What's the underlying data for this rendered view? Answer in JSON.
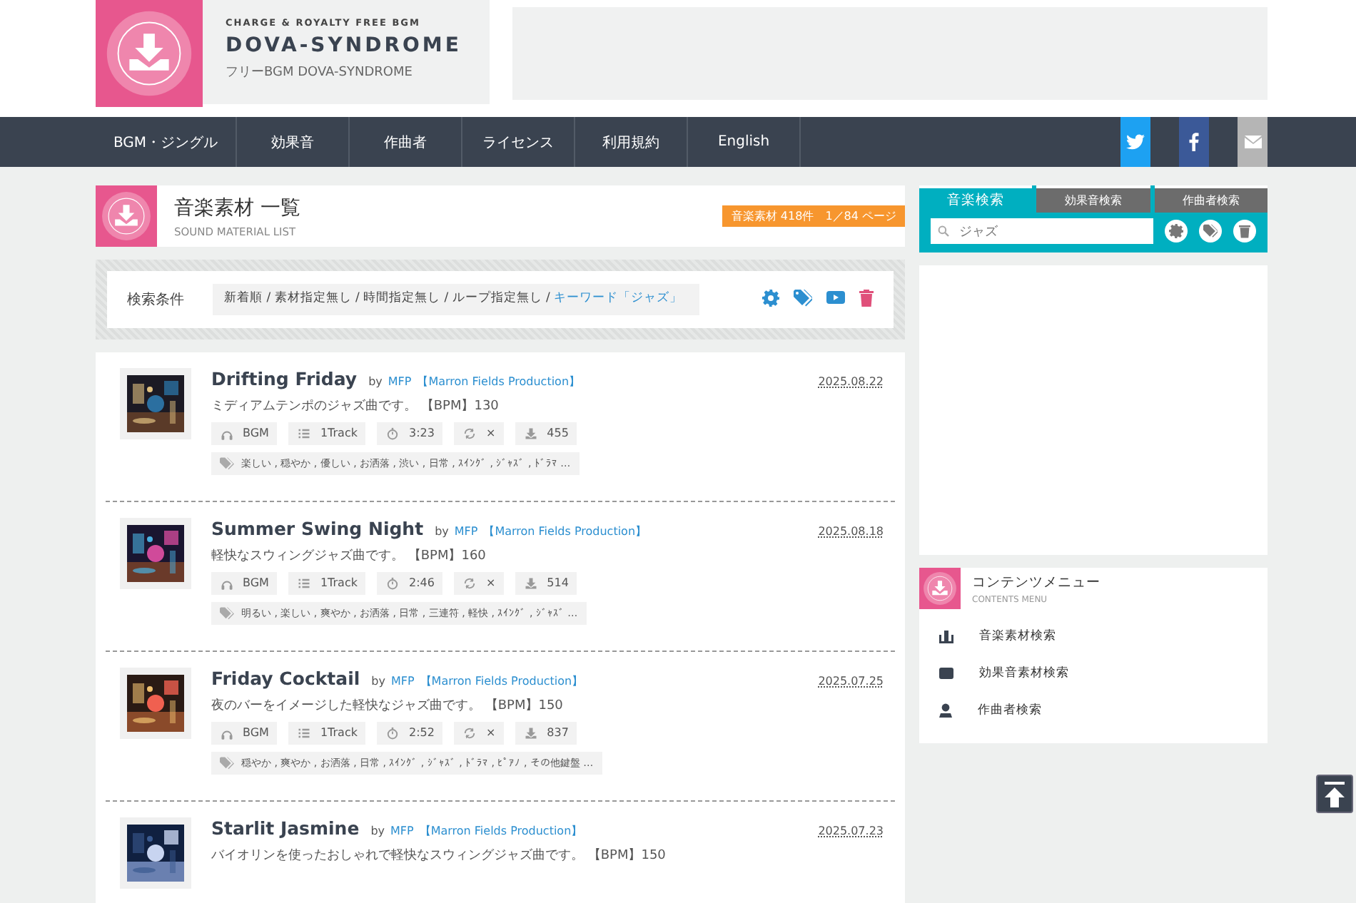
{
  "header": {
    "tagline": "CHARGE & ROYALTY FREE BGM",
    "site_name": "DOVA-SYNDROME",
    "subtitle": "フリーBGM DOVA-SYNDROME"
  },
  "nav": {
    "items": [
      "BGM・ジングル",
      "効果音",
      "作曲者",
      "ライセンス",
      "利用規約",
      "English"
    ],
    "social": [
      {
        "kind": "twitter"
      },
      {
        "kind": "facebook"
      },
      {
        "kind": "mail"
      }
    ]
  },
  "page_heading": {
    "title": "音楽素材 一覧",
    "subtitle": "SOUND MATERIAL LIST",
    "count_badge": "音楽素材 418件　1／84 ページ"
  },
  "search_conditions": {
    "label": "検索条件",
    "conditions": "新着順 / 素材指定無し / 時間指定無し / ループ指定無し / ",
    "keyword": "キーワード「ジャズ」"
  },
  "items": [
    {
      "title": "Drifting Friday",
      "by": "by",
      "artist": "MFP",
      "label": "【Marron Fields Production】",
      "date": "2025.08.22",
      "description": "ミディアムテンポのジャズ曲です。 【BPM】130",
      "stats": {
        "type": "BGM",
        "tracks": "1Track",
        "duration": "3:23",
        "loop": "×",
        "downloads": "455"
      },
      "tags": "楽しい , 穏やか , 優しい , お洒落 , 渋い , 日常 , ｽｲﾝｸﾞ , ｼﾞｬｽﾞ , ﾄﾞﾗﾏ …",
      "kind": "picture"
    },
    {
      "title": "Summer Swing Night",
      "by": "by",
      "artist": "MFP",
      "label": "【Marron Fields Production】",
      "date": "2025.08.18",
      "description": "軽快なスウィングジャズ曲です。 【BPM】160",
      "stats": {
        "type": "BGM",
        "tracks": "1Track",
        "duration": "2:46",
        "loop": "×",
        "downloads": "514"
      },
      "tags": "明るい , 楽しい , 爽やか , お洒落 , 日常 , 三連符 , 軽快 , ｽｲﾝｸﾞ , ｼﾞｬｽﾞ …",
      "kind": "picture"
    },
    {
      "title": "Friday Cocktail",
      "by": "by",
      "artist": "MFP",
      "label": "【Marron Fields Production】",
      "date": "2025.07.25",
      "description": "夜のバーをイメージした軽快なジャズ曲です。 【BPM】150",
      "stats": {
        "type": "BGM",
        "tracks": "1Track",
        "duration": "2:52",
        "loop": "×",
        "downloads": "837"
      },
      "tags": "穏やか , 爽やか , お洒落 , 日常 , ｽｲﾝｸﾞ , ｼﾞｬｽﾞ , ﾄﾞﾗﾏ , ﾋﾟｱﾉ , その他鍵盤 …",
      "kind": "picture"
    },
    {
      "title": "Starlit Jasmine",
      "by": "by",
      "artist": "MFP",
      "label": "【Marron Fields Production】",
      "date": "2025.07.23",
      "description": "バイオリンを使ったおしゃれで軽快なスウィングジャズ曲です。 【BPM】150",
      "kind": "picture"
    }
  ],
  "sidebar": {
    "search_tabs": [
      {
        "label": "音楽検索",
        "selected": true
      },
      {
        "label": "効果音検索",
        "selected": false
      },
      {
        "label": "作曲者検索",
        "selected": false
      }
    ],
    "search_value": "ジャズ",
    "menu": {
      "title": "コンテンツメニュー",
      "subtitle": "CONTENTS MENU",
      "items": [
        {
          "label": "音楽素材検索",
          "kind": "music"
        },
        {
          "label": "効果音素材検索",
          "kind": "effect"
        },
        {
          "label": "作曲者検索",
          "kind": "composer"
        }
      ]
    }
  }
}
